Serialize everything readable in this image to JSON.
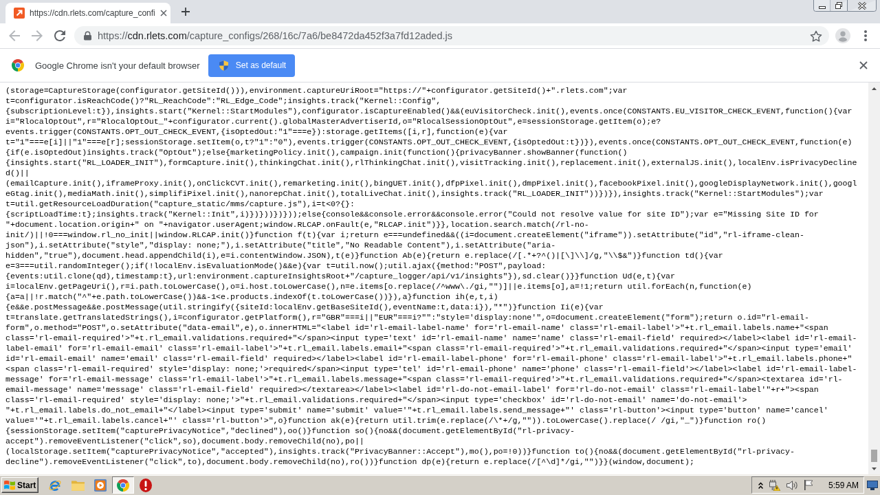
{
  "tabs": [
    {
      "title": "https://cdn.rlets.com/capture_confi",
      "selected": true
    }
  ],
  "nav_buttons": [
    {
      "kind": "back",
      "disabled": true
    },
    {
      "kind": "forward",
      "disabled": true
    },
    {
      "kind": "reload",
      "disabled": false
    }
  ],
  "address_bar": {
    "scheme": "https://",
    "host": "cdn.rlets.com",
    "path": "/capture_configs/268/16c/7a6/be8472da452f3a7fd12aded.js"
  },
  "infobar": {
    "message": "Google Chrome isn't your default browser",
    "button": "Set as default"
  },
  "code_lines": [
    "(storage=CaptureStorage(configurator.getSiteId())),environment.captureUriRoot=\"https://\"+configurator.getSiteId()+\".rlets.com\";var",
    "t=configurator.isReachCode()?\"RL_ReachCode\":\"RL_Edge_Code\";insights.track(\"Kernel::Config\",",
    "{subscriptionLevel:t}),insights.start(\"Kernel::StartModules\"),configurator.isCaptureEnabled()&&(euVisitorCheck.init(),events.once(CONSTANTS.EU_VISITOR_CHECK_EVENT,function(){var",
    "i=\"RlocalOptOut\",r=\"RlocalOptOut_\"+configurator.current().globalMasterAdvertiserId,o=\"RlocalSessionOptOut\",e=sessionStorage.getItem(o);e?",
    "events.trigger(CONSTANTS.OPT_OUT_CHECK_EVENT,{isOptedOut:\"1\"===e}):storage.getItems([i,r],function(e){var",
    "t=\"1\"===e[i]||\"1\"===e[r];sessionStorage.setItem(o,t?\"1\":\"0\"),events.trigger(CONSTANTS.OPT_OUT_CHECK_EVENT,{isOptedOut:t})}),events.once(CONSTANTS.OPT_OUT_CHECK_EVENT,function(e)",
    "{if(e.isOptedOut)insights.track(\"OptOut\");else{marketingPolicy.init(),campaign.init(function(){privacyBanner.showBanner(function()",
    "{insights.start(\"RL_LOADER_INIT\"),formCapture.init(),thinkingChat.init(),rlThinkingChat.init(),visitTracking.init(),replacement.init(),externalJS.init(),localEnv.isPrivacyDecline",
    "d()||",
    "(emailCapture.init(),iframeProxy.init(),onClickCVT.init(),remarketing.init(),bingUET.init(),dfpPixel.init(),dmpPixel.init(),facebookPixel.init(),googleDisplayNetwork.init(),googl",
    "eGtag.init(),mediaMath.init(),simplifiPixel.init(),nanorepChat.init(),totalLiveChat.init(),insights.track(\"RL_LOADER_INIT\"))})}),insights.track(\"Kernel::StartModules\");var",
    "t=util.getResourceLoadDuration(\"capture_static/mms/capture.js\"),i=t<0?{}:",
    "{scriptLoadTime:t};insights.track(\"Kernel::Init\",i)})}))})}));else{console&&console.error&&console.error(\"Could not resolve value for site ID\");var e=\"Missing Site ID for",
    "\"+document.location.origin+\" on \"+navigator.userAgent;window.RLCAP.onFault(e,\"RLCAP.init\")}},location.search.match(/rl-no-",
    "init/)||!0===window.rl_no_init||window.RLCAP.init()}function f(t){var i;return e===undefined&&((i=document.createElement(\"iframe\")).setAttribute(\"id\",\"rl-iframe-clean-",
    "json\"),i.setAttribute(\"style\",\"display: none;\"),i.setAttribute(\"title\",\"No Readable Content\"),i.setAttribute(\"aria-",
    "hidden\",\"true\"),document.head.appendChild(i),e=i.contentWindow.JSON),t(e)}function Ab(e){return e.replace(/[.*+?^()|[\\]\\\\]/g,\"\\\\$&\")}function td(){var",
    "e=3===util.randomInteger();if(!localEnv.isEvaluationMode()&&e){var t=util.now();util.ajax({method:\"POST\",payload:",
    "{events:util.clone(qd),timestamp:t},url:environment.captureInsightsRoot+\"/capture_logger/api/v1/insights\"}),sd.clear()}}function Ud(e,t){var",
    "i=localEnv.getPageUri(),r=i.path.toLowerCase(),o=i.host.toLowerCase(),n=e.items[o.replace(/^www\\./gi,\"\")]||e.items[o],a=!1;return util.forEach(n,function(e)",
    "{a=a||!r.match(\"^\"+e.path.toLowerCase())&&-1<e.products.indexOf(t.toLowerCase())}),a}function ih(e,t,i)",
    "{e&&e.postMessage&&e.postMessage(util.stringify({siteId:localEnv.getBaseSiteId(),eventName:t,data:i}),\"*\")}function Ii(e){var",
    "t=translate.getTranslatedStrings(),i=configurator.getPlatform(),r=\"GBR\"===i||\"EUR\"===i?\"\":\"style='display:none'\",o=document.createElement(\"form\");return o.id=\"rl-email-",
    "form\",o.method=\"POST\",o.setAttribute(\"data-email\",e),o.innerHTML=\"<label id='rl-email-label-name' for='rl-email-name' class='rl-email-label'>\"+t.rl_email.labels.name+\"<span",
    "class='rl-email-required'>\"+t.rl_email.validations.required+\"</span><input type='text' id='rl-email-name' name='name' class='rl-email-field' required></label><label id='rl-email-",
    "label-email' for='rl-email-email' class='rl-email-label'>\"+t.rl_email.labels.email+\"<span class='rl-email-required'>\"+t.rl_email.validations.required+\"</span><input type='email'",
    "id='rl-email-email' name='email' class='rl-email-field' required></label><label id='rl-email-label-phone' for='rl-email-phone' class='rl-email-label'>\"+t.rl_email.labels.phone+\"",
    "<span class='rl-email-required' style='display: none;'>required</span><input type='tel' id='rl-email-phone' name='phone' class='rl-email-field'></label><label id='rl-email-label-",
    "message' for='rl-email-message' class='rl-email-label'>\"+t.rl_email.labels.message+\"<span class='rl-email-required'>\"+t.rl_email.validations.required+\"</span><textarea id='rl-",
    "email-message' name='message' class='rl-email-field' required></textarea></label><label id='rl-do-not-email-label' for='rl-do-not-email' class='rl-email-label'\"+r+\"><span",
    "class='rl-email-required' style='display: none;'>\"+t.rl_email.validations.required+\"</span><input type='checkbox' id='rl-do-not-email' name='do-not-email'>",
    "\"+t.rl_email.labels.do_not_email+\"</label><input type='submit' name='submit' value='\"+t.rl_email.labels.send_message+\"' class='rl-button'><input type='button' name='cancel'",
    "value='\"+t.rl_email.labels.cancel+\"' class='rl-button'>\",o}function ak(e){return util.trim(e.replace(/\\*+/g,\"\")).toLowerCase().replace(/ /gi,\"_\")}function ro()",
    "{sessionStorage.setItem(\"capturePrivacyNotice\",\"declined\"),oo()}function so(){no&&(document.getElementById(\"rl-privacy-",
    "accept\").removeEventListener(\"click\",so),document.body.removeChild(no),po||",
    "(localStorage.setItem(\"capturePrivacyNotice\",\"accepted\"),insights.track(\"PrivacyBanner::Accept\"),mo(),po=!0))}function to(){no&&(document.getElementById(\"rl-privacy-",
    "decline\").removeEventListener(\"click\",to),document.body.removeChild(no),ro())}function dp(e){return e.replace(/[^\\d]*/gi,\"\")}}(window,document);"
  ],
  "taskbar": {
    "start": "Start",
    "apps": [
      {
        "kind": "ie",
        "selected": false
      },
      {
        "kind": "folder",
        "selected": false
      },
      {
        "kind": "player",
        "selected": false
      },
      {
        "kind": "chrome",
        "selected": true
      },
      {
        "kind": "alert",
        "selected": false
      }
    ],
    "clock": "5:59 AM"
  }
}
